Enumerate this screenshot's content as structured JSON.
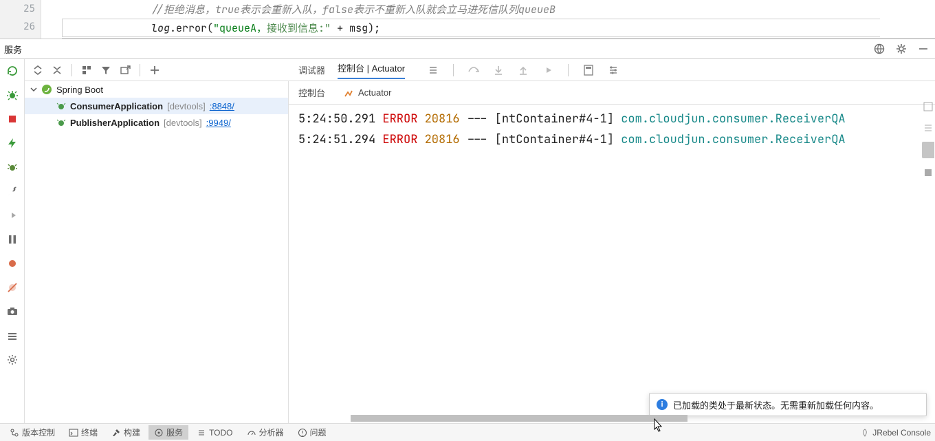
{
  "editor": {
    "line_nums": [
      "25",
      "26"
    ],
    "comment": "//拒绝消息，true表示会重新入队，false表示不重新入队就会立马进死信队列queueB",
    "code_prefix": "log",
    "code_method": ".error(",
    "code_str_a": "\"queueA，",
    "code_str_b": "接收到信息:\"",
    "code_after": " + msg);"
  },
  "panel": {
    "title": "服务"
  },
  "tree": {
    "root": "Spring Boot",
    "apps": [
      {
        "name": "ConsumerApplication",
        "dev": "[devtools]",
        "port": ":8848/"
      },
      {
        "name": "PublisherApplication",
        "dev": "[devtools]",
        "port": ":9949/"
      }
    ]
  },
  "tabs1": {
    "a": "调试器",
    "b": "控制台 | Actuator"
  },
  "tabs2": {
    "a": "控制台",
    "b": "Actuator"
  },
  "log": {
    "rows": [
      {
        "ts": "5:24:50.291",
        "level": "ERROR",
        "pid": "20816",
        "sep": "---",
        "thr": "[ntContainer#4-1]",
        "logger": "com.cloudjun.consumer.ReceiverQA"
      },
      {
        "ts": "5:24:51.294",
        "level": "ERROR",
        "pid": "20816",
        "sep": "---",
        "thr": "[ntContainer#4-1]",
        "logger": "com.cloudjun.consumer.ReceiverQA"
      }
    ]
  },
  "notif": {
    "msg": "已加载的类处于最新状态。无需重新加载任何内容。"
  },
  "status": {
    "items": [
      {
        "label": "版本控制"
      },
      {
        "label": "终端"
      },
      {
        "label": "构建"
      },
      {
        "label": "服务"
      },
      {
        "label": "TODO"
      },
      {
        "label": "分析器"
      },
      {
        "label": "问题"
      }
    ],
    "right": "JRebel Console"
  }
}
